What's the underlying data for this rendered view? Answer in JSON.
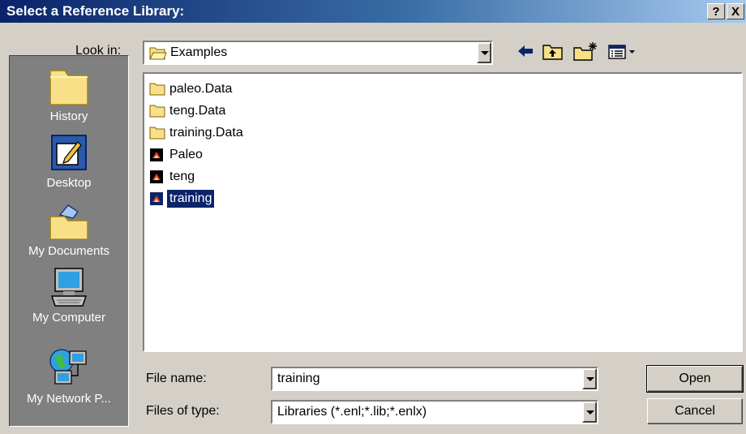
{
  "window": {
    "title": "Select a Reference Library:",
    "help_label": "?",
    "close_label": "X"
  },
  "lookin": {
    "label": "Look in:",
    "value": "Examples"
  },
  "places": [
    {
      "label": "History",
      "icon": "history-icon"
    },
    {
      "label": "Desktop",
      "icon": "desktop-icon"
    },
    {
      "label": "My Documents",
      "icon": "my-documents-icon"
    },
    {
      "label": "My Computer",
      "icon": "my-computer-icon"
    },
    {
      "label": "My Network P...",
      "icon": "my-network-places-icon"
    }
  ],
  "files": [
    {
      "name": "paleo.Data",
      "icon": "folder-icon"
    },
    {
      "name": "teng.Data",
      "icon": "folder-icon"
    },
    {
      "name": "training.Data",
      "icon": "folder-icon"
    },
    {
      "name": "Paleo",
      "icon": "endnote-library-icon"
    },
    {
      "name": "teng",
      "icon": "endnote-library-icon"
    },
    {
      "name": "training",
      "icon": "endnote-library-icon",
      "selected": true
    }
  ],
  "filename": {
    "label": "File name:",
    "value": "training"
  },
  "filetype": {
    "label": "Files of type:",
    "value": "Libraries (*.enl;*.lib;*.enlx)"
  },
  "buttons": {
    "open": "Open",
    "cancel": "Cancel"
  },
  "colors": {
    "title_bar": "#0a246a",
    "face": "#d4d0c8",
    "places_bar": "#808080",
    "selection": "#0a246a"
  }
}
